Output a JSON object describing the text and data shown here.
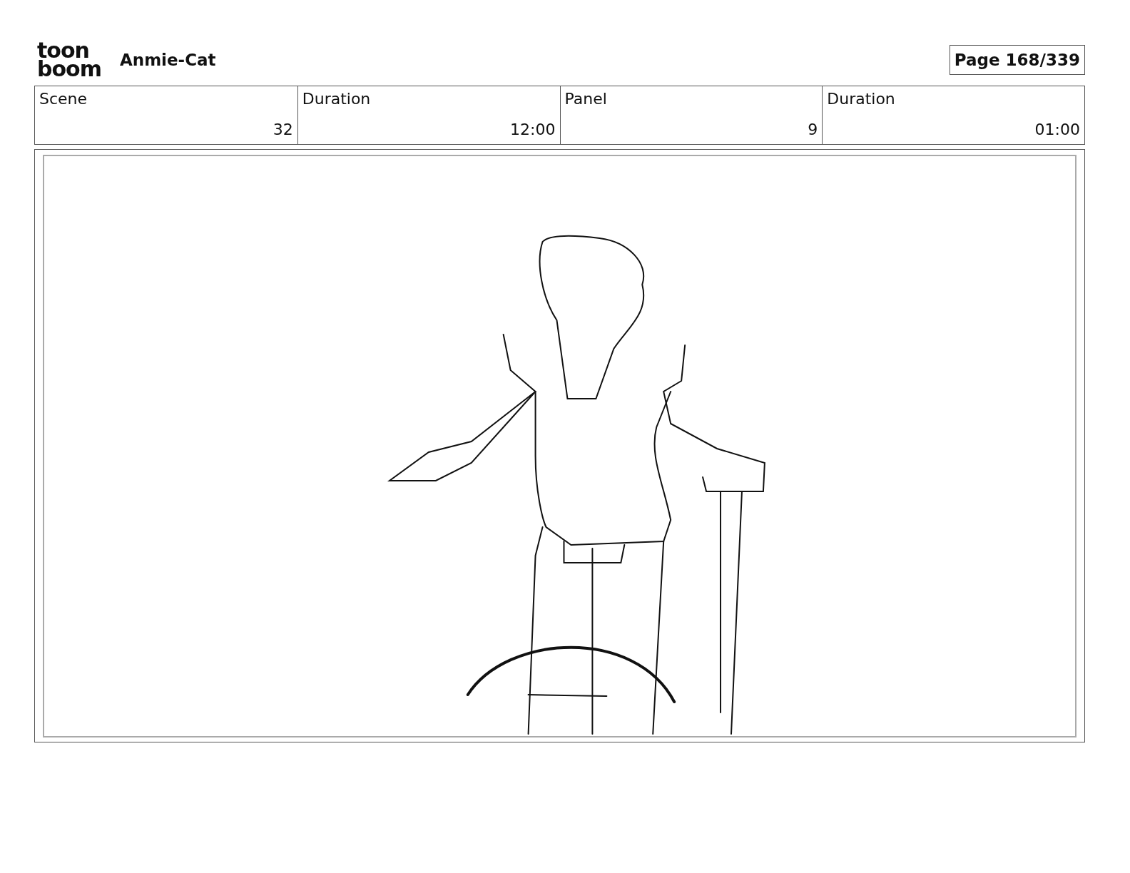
{
  "header": {
    "logo": [
      "toon",
      "boom"
    ],
    "project_title": "Anmie-Cat",
    "page": "Page 168/339"
  },
  "info_table": {
    "columns": [
      "Scene",
      "Duration",
      "Panel",
      "Duration"
    ],
    "values": [
      "32",
      "12:00",
      "9",
      "01:00"
    ]
  }
}
